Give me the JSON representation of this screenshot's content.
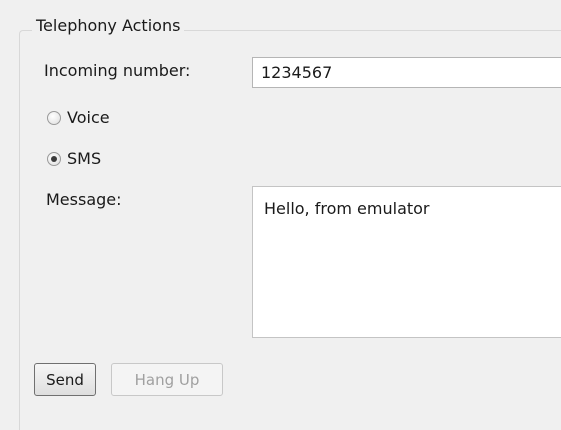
{
  "group": {
    "title": "Telephony Actions"
  },
  "incoming": {
    "label": "Incoming number:",
    "value": "1234567"
  },
  "call_type": {
    "options": [
      {
        "label": "Voice",
        "checked": false
      },
      {
        "label": "SMS",
        "checked": true
      }
    ]
  },
  "message": {
    "label": "Message:",
    "value": "Hello, from emulator"
  },
  "buttons": {
    "send": "Send",
    "hang_up": "Hang Up"
  }
}
